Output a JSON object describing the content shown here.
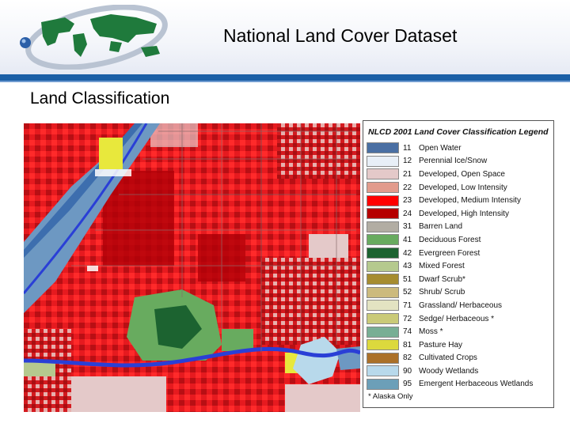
{
  "header": {
    "title": "National Land Cover Dataset"
  },
  "slide": {
    "subtitle": "Land Classification"
  },
  "legend": {
    "title": "NLCD 2001 Land Cover Classification Legend",
    "items": [
      {
        "code": "11",
        "label": "Open Water",
        "color": "#4a6fa3"
      },
      {
        "code": "12",
        "label": "Perennial Ice/Snow",
        "color": "#e8eff7"
      },
      {
        "code": "21",
        "label": "Developed, Open Space",
        "color": "#e4c9c9"
      },
      {
        "code": "22",
        "label": "Developed, Low Intensity",
        "color": "#e29b8c"
      },
      {
        "code": "23",
        "label": "Developed, Medium Intensity",
        "color": "#ff0000"
      },
      {
        "code": "24",
        "label": "Developed, High Intensity",
        "color": "#b50000"
      },
      {
        "code": "31",
        "label": "Barren Land",
        "color": "#b2ada3"
      },
      {
        "code": "41",
        "label": "Deciduous Forest",
        "color": "#68ab5f"
      },
      {
        "code": "42",
        "label": "Evergreen Forest",
        "color": "#1c6330"
      },
      {
        "code": "43",
        "label": "Mixed Forest",
        "color": "#b5c98e"
      },
      {
        "code": "51",
        "label": "Dwarf Scrub*",
        "color": "#a68c30"
      },
      {
        "code": "52",
        "label": "Shrub/ Scrub",
        "color": "#ccba7d"
      },
      {
        "code": "71",
        "label": "Grassland/ Herbaceous",
        "color": "#e3e3c2"
      },
      {
        "code": "72",
        "label": "Sedge/ Herbaceous *",
        "color": "#caca78"
      },
      {
        "code": "74",
        "label": "Moss *",
        "color": "#78ae94"
      },
      {
        "code": "81",
        "label": "Pasture Hay",
        "color": "#dcd93d"
      },
      {
        "code": "82",
        "label": "Cultivated Crops",
        "color": "#ab7028"
      },
      {
        "code": "90",
        "label": "Woody Wetlands",
        "color": "#b8d9eb"
      },
      {
        "code": "95",
        "label": "Emergent Herbaceous Wetlands",
        "color": "#6c9fb8"
      }
    ],
    "note": "* Alaska Only"
  }
}
